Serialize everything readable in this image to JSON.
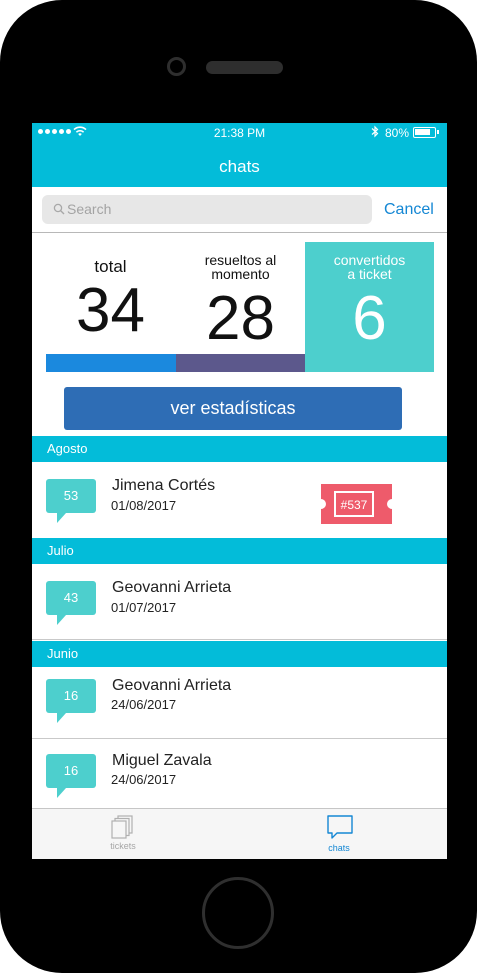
{
  "status_bar": {
    "time": "21:38 PM",
    "battery": "80%"
  },
  "header": {
    "title": "chats"
  },
  "search": {
    "placeholder": "Search",
    "cancel_label": "Cancel"
  },
  "stats": [
    {
      "label": "total",
      "value": "34"
    },
    {
      "label_line1": "resueltos al",
      "label_line2": "momento",
      "value": "28"
    },
    {
      "label_line1": "convertidos",
      "label_line2": "a ticket",
      "value": "6"
    }
  ],
  "stats_button": "ver estadísticas",
  "sections": [
    {
      "title": "Agosto",
      "items": [
        {
          "count": "53",
          "name": "Jimena Cortés",
          "date": "01/08/2017",
          "ticket": "#537"
        }
      ]
    },
    {
      "title": "Julio",
      "items": [
        {
          "count": "43",
          "name": "Geovanni Arrieta",
          "date": "01/07/2017"
        }
      ]
    },
    {
      "title": "Junio",
      "items": [
        {
          "count": "16",
          "name": "Geovanni Arrieta",
          "date": "24/06/2017"
        },
        {
          "count": "16",
          "name": "Miguel Zavala",
          "date": "24/06/2017"
        }
      ]
    }
  ],
  "tabs": [
    {
      "label": "tickets",
      "icon": "documents-icon",
      "active": false
    },
    {
      "label": "chats",
      "icon": "chat-bubble-icon",
      "active": true
    }
  ],
  "colors": {
    "header": "#03bcd9",
    "total_bar": "#1b89de",
    "resolved_bar": "#5c588c",
    "converted_bg": "#4dcfcd",
    "button": "#2e6db5",
    "ticket": "#ee5b6b",
    "active_tab": "#1487d4"
  }
}
